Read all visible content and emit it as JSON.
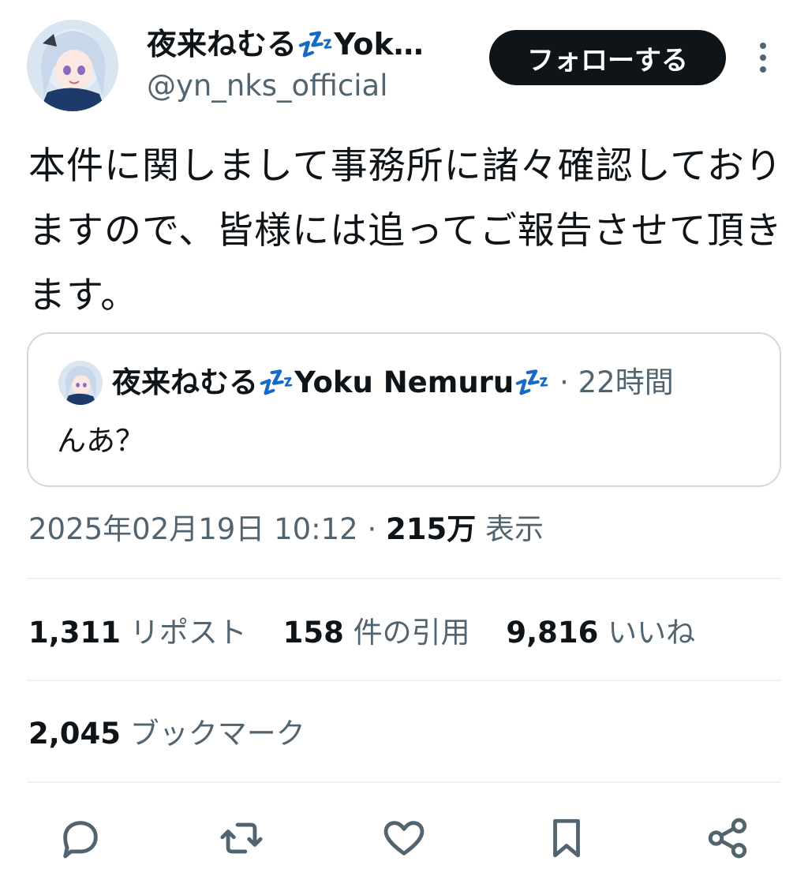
{
  "author": {
    "name": "夜来ねむる💤Yok…",
    "handle": "@yn_nks_official",
    "avatar_icon": "anime-character-avatar"
  },
  "follow_label": "フォローする",
  "tweet_text": "本件に関しまして事務所に諸々確認しておりますので、皆様には追ってご報告させて頂きます。",
  "quote": {
    "name": "夜来ねむる💤Yoku Nemuru💤",
    "separator": " · ",
    "time": "22時間",
    "text": "んあ？"
  },
  "meta": {
    "datetime": "2025年02月19日 10:12",
    "separator": " · ",
    "views": "215万",
    "views_label": " 表示"
  },
  "stats": {
    "reposts": {
      "count": "1,311",
      "label": " リポスト"
    },
    "quotes": {
      "count": "158",
      "label": " 件の引用"
    },
    "likes": {
      "count": "9,816",
      "label": " いいね"
    }
  },
  "bookmarks": {
    "count": "2,045",
    "label": " ブックマーク"
  },
  "actions": [
    "reply-icon",
    "repost-icon",
    "like-icon",
    "bookmark-icon",
    "share-icon"
  ],
  "colors": {
    "text_primary": "#0f1419",
    "text_secondary": "#536471",
    "border": "#cfd9de",
    "divider": "#eff3f4",
    "button_bg": "#0f1419"
  }
}
